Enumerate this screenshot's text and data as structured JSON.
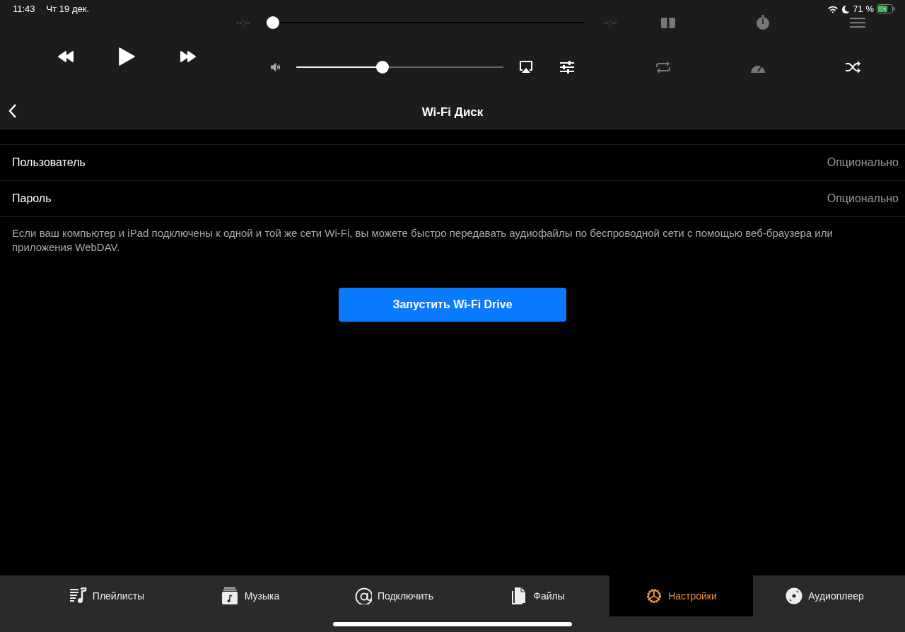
{
  "status_bar": {
    "time": "11:43",
    "date": "Чт 19 дек.",
    "battery_percent": "71 %",
    "battery": {
      "level": 0.71,
      "charging": true
    }
  },
  "player": {
    "elapsed": "--:--",
    "remaining": "--:--",
    "seek": {
      "level": 0
    },
    "volume": {
      "level": 0.41
    }
  },
  "nav": {
    "title": "Wi-Fi Диск"
  },
  "settings": [
    {
      "label": "Пользователь",
      "placeholder": "Опционально"
    },
    {
      "label": "Пароль",
      "placeholder": "Опционально"
    }
  ],
  "description": "Если ваш компьютер и iPad подключены к одной и той же сети Wi-Fi, вы можете быстро передавать аудиофайлы по беспроводной сети с помощью веб-браузера или приложения WebDAV.",
  "start_button": "Запустить Wi-Fi Drive",
  "tabs": [
    {
      "kind": "playlists",
      "label": "Плейлисты",
      "selected": false
    },
    {
      "kind": "music",
      "label": "Музыка",
      "selected": false
    },
    {
      "kind": "connect",
      "label": "Подключить",
      "selected": false
    },
    {
      "kind": "files",
      "label": "Файлы",
      "selected": false
    },
    {
      "kind": "settings",
      "label": "Настройки",
      "selected": true
    },
    {
      "kind": "player",
      "label": "Аудиоплеер",
      "selected": false
    }
  ]
}
